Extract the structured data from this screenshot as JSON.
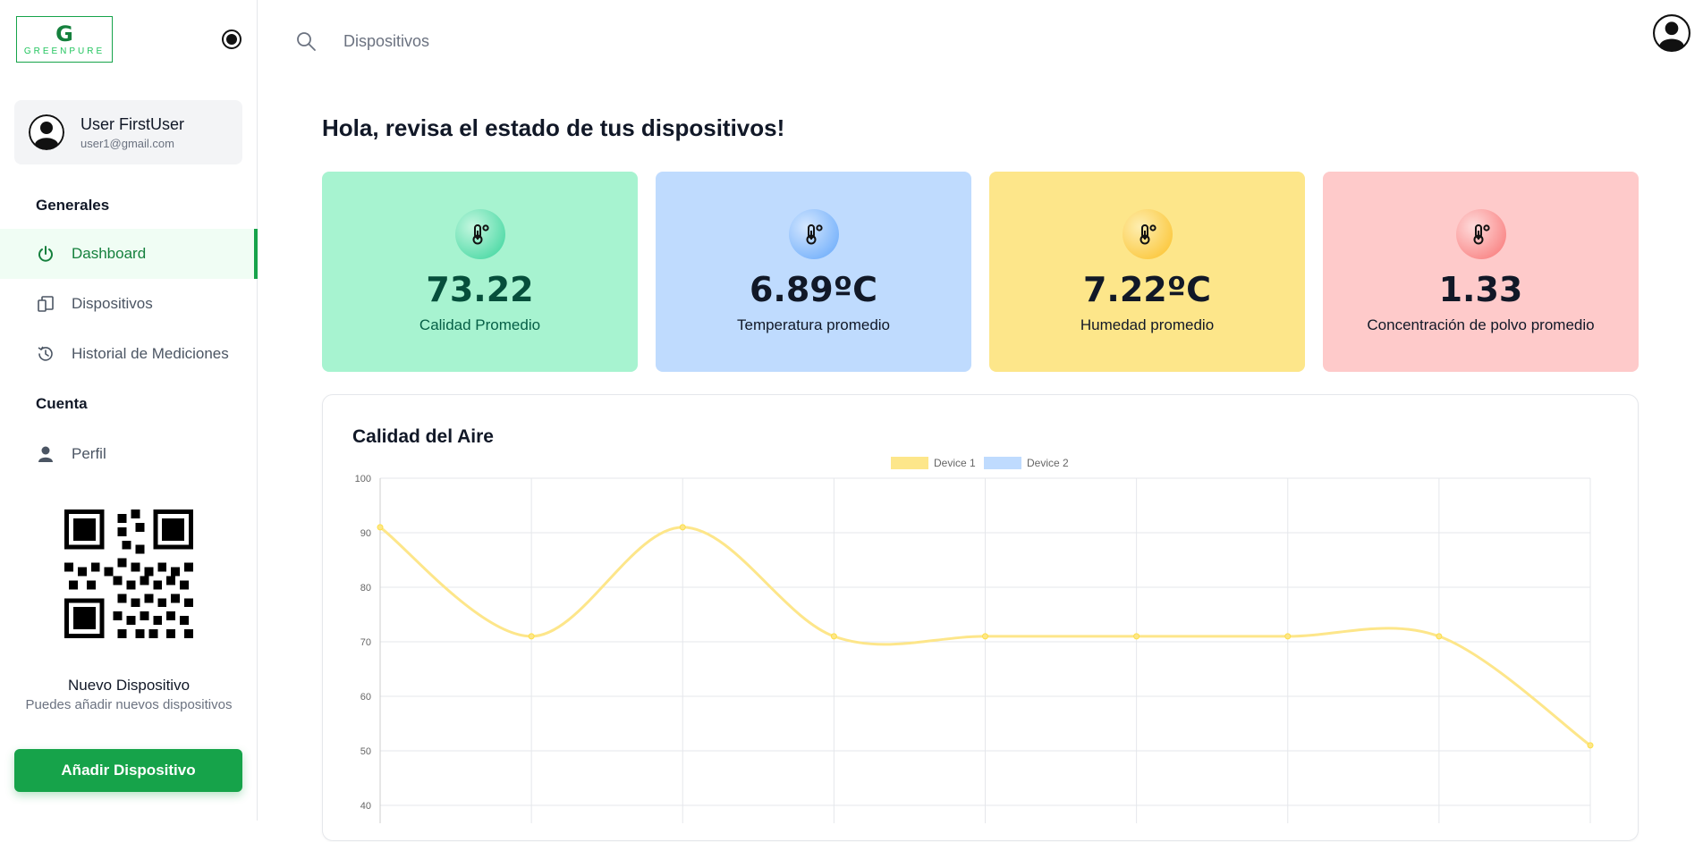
{
  "brand": {
    "logo_letter": "G",
    "logo_word": "GREENPURE"
  },
  "user": {
    "name": "User FirstUser",
    "email": "user1@gmail.com"
  },
  "sidebar": {
    "section_general": "Generales",
    "items": [
      {
        "label": "Dashboard",
        "icon": "power-icon",
        "active": true
      },
      {
        "label": "Dispositivos",
        "icon": "devices-icon",
        "active": false
      },
      {
        "label": "Historial de Mediciones",
        "icon": "history-icon",
        "active": false
      }
    ],
    "section_account": "Cuenta",
    "account_items": [
      {
        "label": "Perfil",
        "icon": "user-icon"
      }
    ],
    "new_device_title": "Nuevo Dispositivo",
    "new_device_subtitle": "Puedes añadir nuevos dispositivos",
    "add_button": "Añadir Dispositivo"
  },
  "search": {
    "value": "Dispositivos"
  },
  "main": {
    "greeting": "Hola, revisa el estado de tus dispositivos!",
    "stats": [
      {
        "value": "73.22",
        "label": "Calidad Promedio",
        "bg": "#a7f3d0",
        "icon_bg": "#34d399",
        "value_color": "#064e3b",
        "label_color": "#065f46"
      },
      {
        "value": "6.89ºC",
        "label": "Temperatura promedio",
        "bg": "#bfdbfe",
        "icon_bg": "#60a5fa",
        "value_color": "#111827",
        "label_color": "#111827"
      },
      {
        "value": "7.22ºC",
        "label": "Humedad promedio",
        "bg": "#fde68a",
        "icon_bg": "#fbbf24",
        "value_color": "#111827",
        "label_color": "#111827"
      },
      {
        "value": "1.33",
        "label": "Concentración de polvo promedio",
        "bg": "#fecaca",
        "icon_bg": "#f87171",
        "value_color": "#111827",
        "label_color": "#111827"
      }
    ]
  },
  "chart_data": {
    "type": "line",
    "title": "Calidad del Aire",
    "x": [
      0,
      1,
      2,
      3,
      4,
      5,
      6,
      7,
      8
    ],
    "series": [
      {
        "name": "Device 1",
        "color": "#fde68a",
        "values": [
          91,
          71,
          91,
          71,
          71,
          71,
          71,
          71,
          51
        ]
      },
      {
        "name": "Device 2",
        "color": "#bfdbfe",
        "values": []
      }
    ],
    "yticks": [
      100,
      90,
      80,
      70,
      60,
      50,
      40
    ],
    "ylim": [
      40,
      100
    ],
    "grid": true,
    "legend": "top"
  }
}
